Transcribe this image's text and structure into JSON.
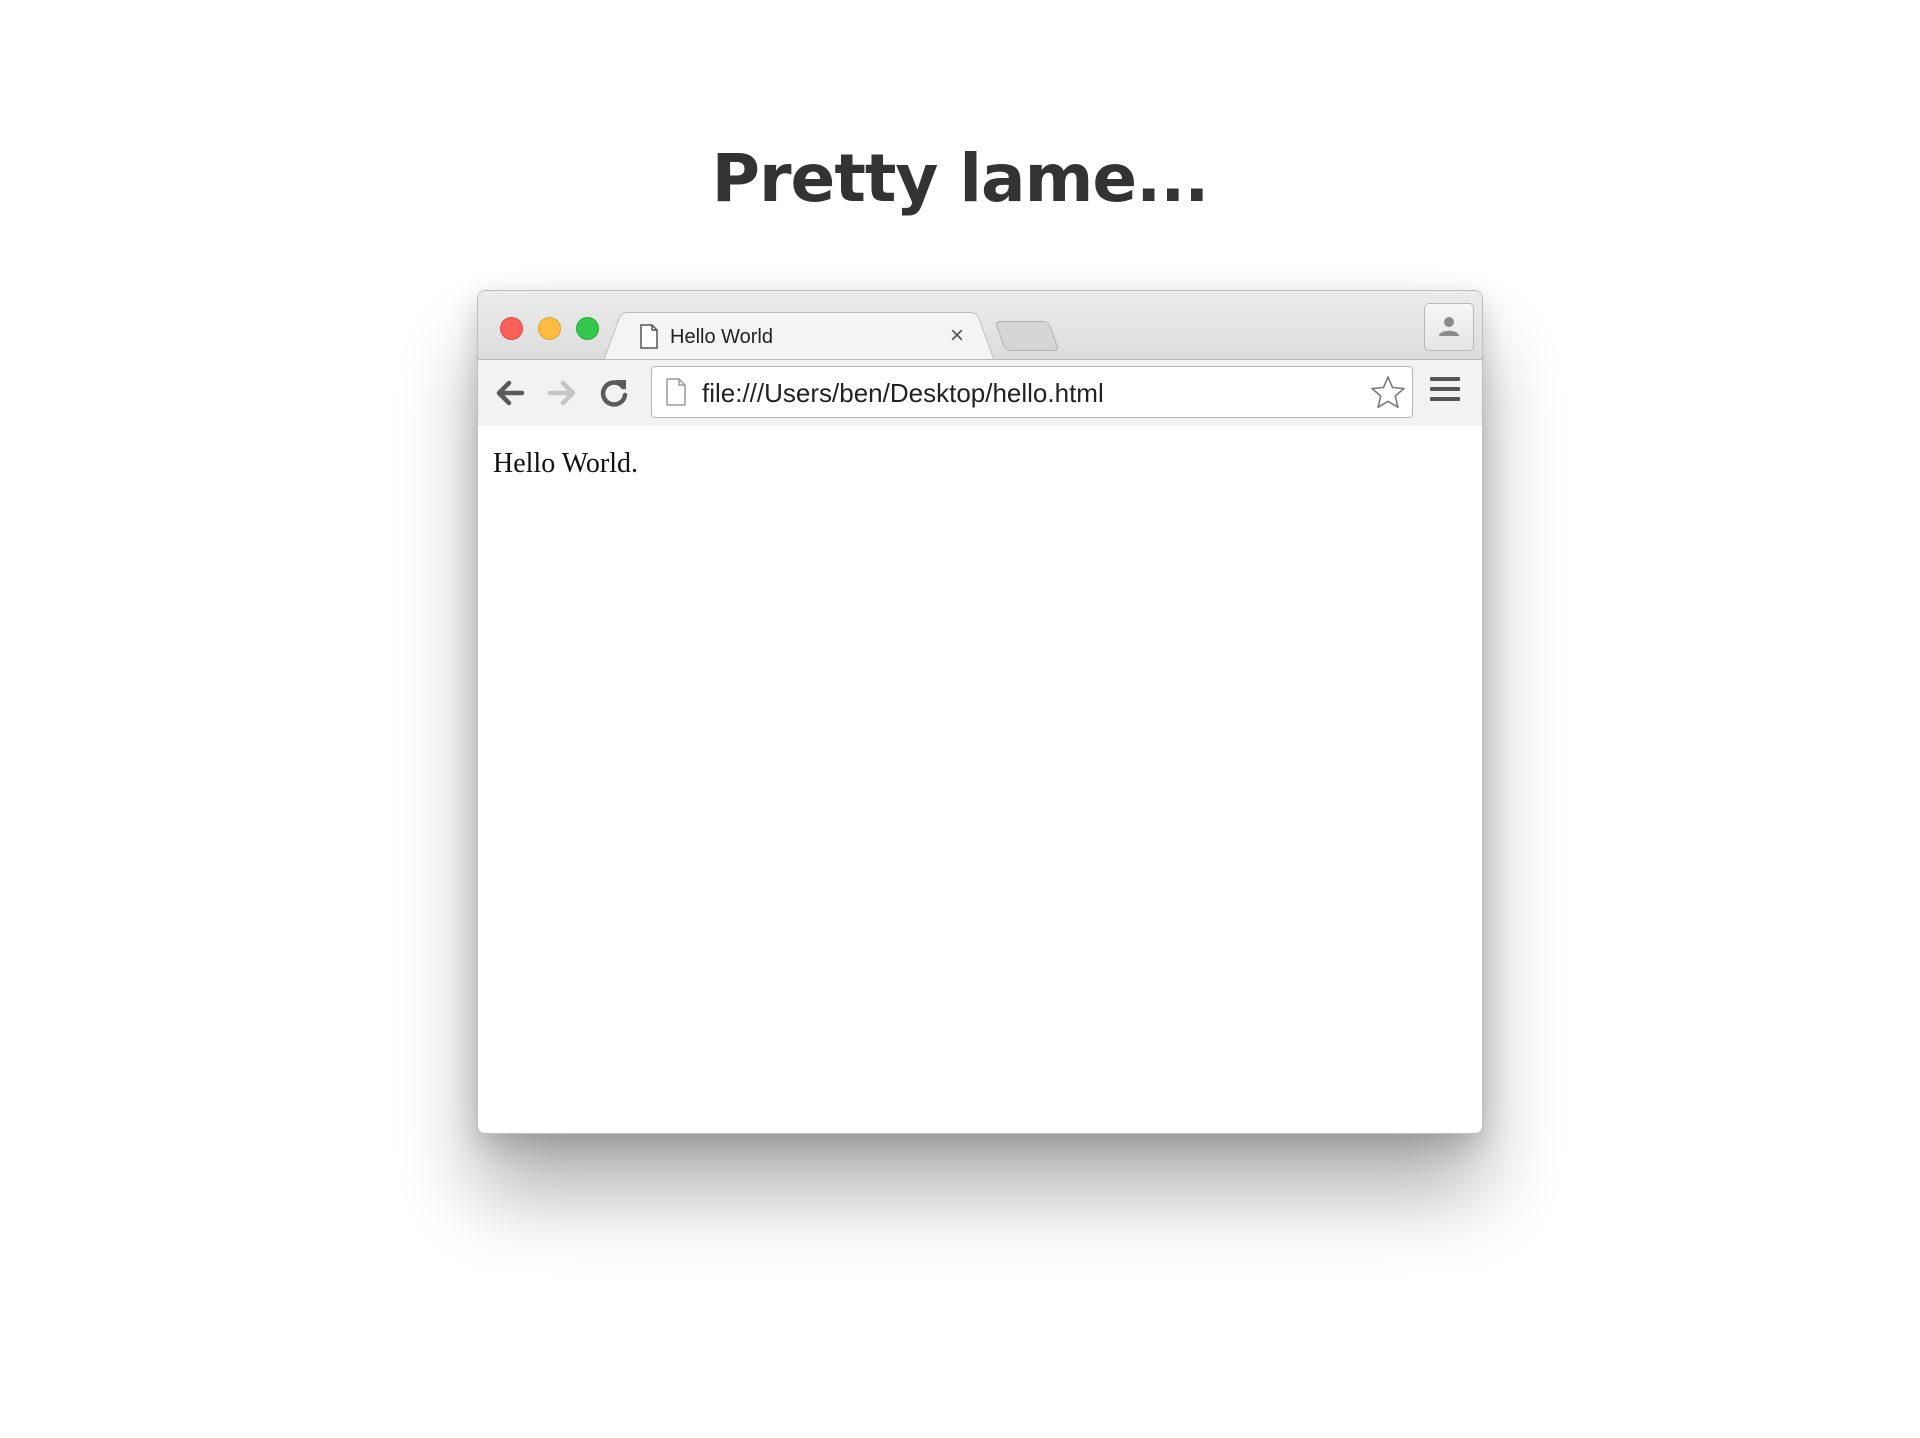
{
  "slide": {
    "title": "Pretty lame..."
  },
  "browser": {
    "tab": {
      "title": "Hello World",
      "close_symbol": "×"
    },
    "address_bar": {
      "url": "file:///Users/ben/Desktop/hello.html"
    },
    "icons": {
      "back": "arrow-left-icon",
      "forward": "arrow-right-icon",
      "reload": "reload-icon",
      "page": "page-icon",
      "bookmark": "star-icon",
      "menu": "hamburger-menu-icon",
      "profile": "person-icon"
    },
    "window_controls": {
      "close_color": "#fc605b",
      "minimize_color": "#fdbc40",
      "maximize_color": "#34c84a"
    },
    "page": {
      "body_text": "Hello World."
    }
  }
}
